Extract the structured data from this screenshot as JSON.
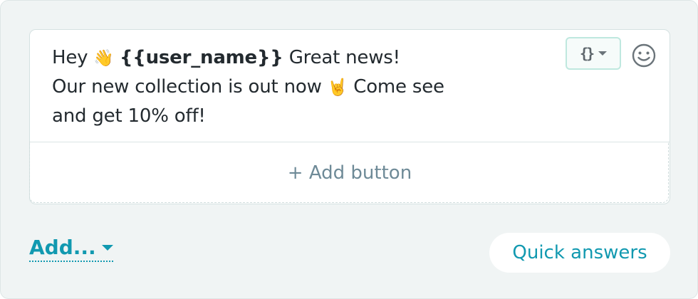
{
  "message": {
    "greeting": "Hey",
    "wave_emoji": "👋",
    "variable": "{{user_name}}",
    "line1_rest": "Great news!",
    "line2_start": "Our new collection is out now",
    "rock_emoji": "🤘",
    "line2_end": "Come see",
    "line3": "and get 10% off!"
  },
  "toolbar": {
    "variable_button_label": "{}",
    "variable_icon": "braces-icon",
    "emoji_icon": "smiley-icon"
  },
  "add_button_label": "+ Add button",
  "footer": {
    "add_menu_label": "Add...",
    "quick_answers_label": "Quick answers"
  },
  "colors": {
    "accent": "#1199b0",
    "panel_bg": "#f0f4f4",
    "text": "#232a2f",
    "muted_link": "#6e8a97"
  }
}
